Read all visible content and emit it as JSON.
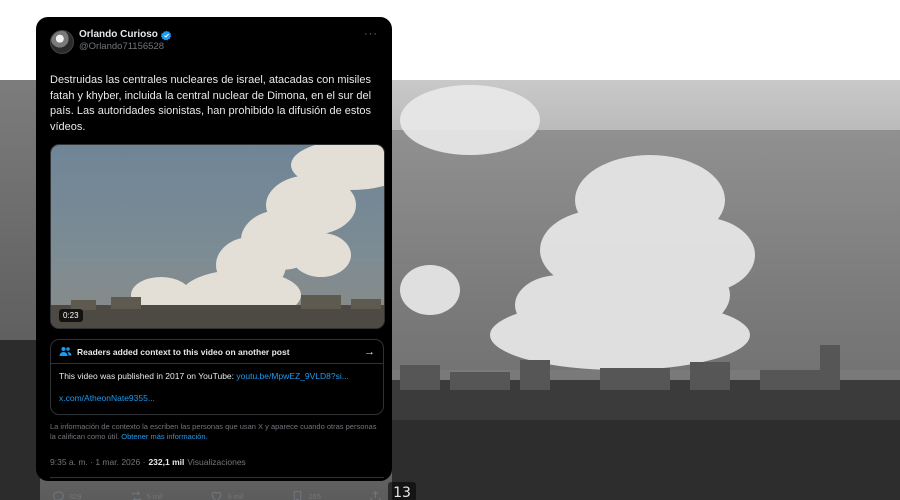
{
  "background": {
    "timestamp": "13"
  },
  "tweet": {
    "display_name": "Orlando Curioso",
    "handle": "@Orlando71156528",
    "text": "Destruidas las centrales nucleares de israel, atacadas con misiles fatah y khyber, incluida la central nuclear de Dimona, en el sur del país. Las autoridades sionistas, han prohibido la difusión de estos vídeos.",
    "video_duration": "0:23",
    "posted_at": "9:35 a. m. · 1 mar. 2026 ·",
    "views_count": "232,1 mil",
    "views_label": "Visualizaciones"
  },
  "community_note": {
    "title": "Readers added context to this video on another post",
    "body_prefix": "This video was published in 2017 on YouTube: ",
    "body_link": "youtu.be/MpwEZ_9VLD8?si...",
    "secondary_link": "x.com/AtheonNate9355...",
    "disclaimer": "La información de contexto la escriben las personas que usan X y aparece cuando otras personas la califican como útil.",
    "disclaimer_link": "Obtener más información."
  },
  "actions": {
    "replies": "329",
    "reposts": "5 mil",
    "likes": "9 mil",
    "bookmarks": "265"
  },
  "colors": {
    "accent": "#1d9bf0",
    "card_background": "#000000",
    "muted_text": "#71767b"
  }
}
